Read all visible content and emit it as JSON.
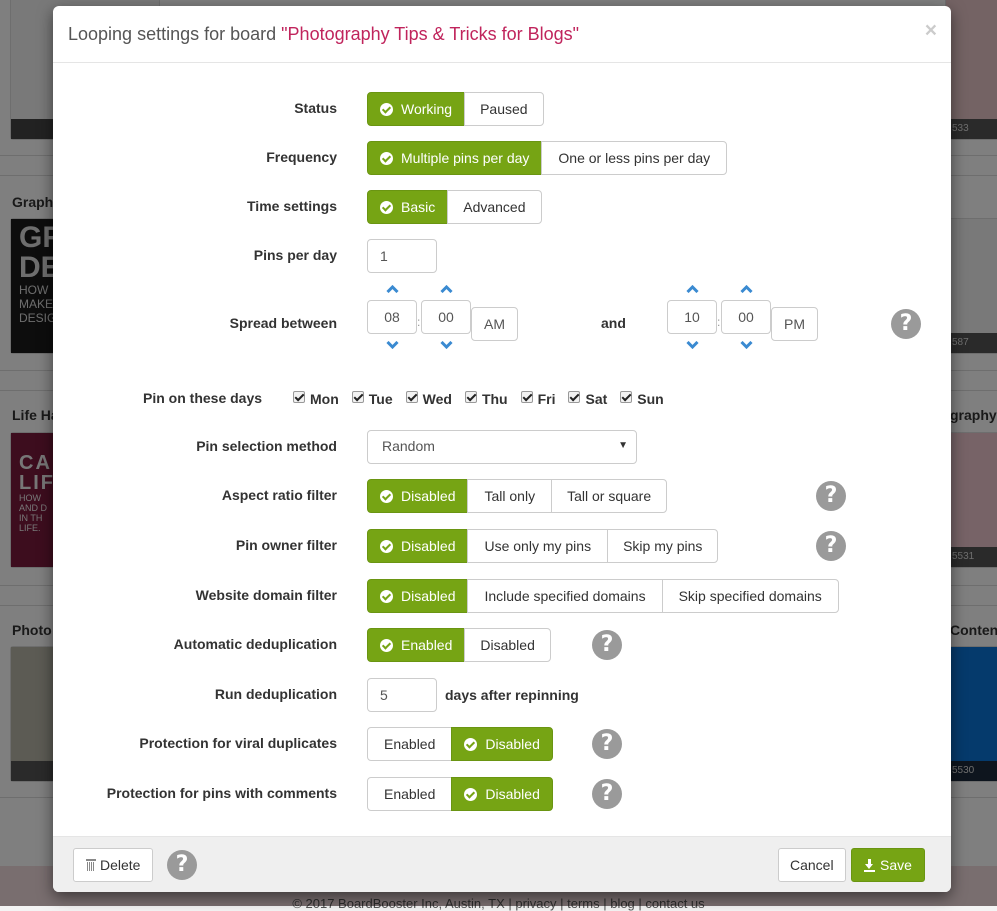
{
  "background": {
    "sections": [
      {
        "heading": "Graph"
      },
      {
        "heading": "Life Ha"
      },
      {
        "heading": "Photo"
      },
      {
        "heading": "graphy"
      },
      {
        "heading": "Content"
      }
    ],
    "card_counts": [
      "533",
      "587",
      "5531",
      "5530"
    ],
    "thumb_texts": {
      "graphic": [
        "GR",
        "DE",
        "HOW",
        "MAKE",
        "DESIG"
      ],
      "life": [
        "CA",
        "LIF",
        "HOW",
        "AND D",
        "IN TH",
        "LIFE."
      ]
    },
    "footer_text": "© 2017 BoardBooster Inc, Austin, TX | privacy | terms | blog | contact us"
  },
  "modal": {
    "title_prefix": "Looping settings for board ",
    "board_name": "\"Photography Tips & Tricks for Blogs\"",
    "close_label": "×",
    "accent_color": "#76a414",
    "board_name_color": "#c0245c",
    "fields": {
      "status": {
        "label": "Status",
        "options": [
          "Working",
          "Paused"
        ],
        "selected": "Working"
      },
      "frequency": {
        "label": "Frequency",
        "options": [
          "Multiple pins per day",
          "One or less pins per day"
        ],
        "selected": "Multiple pins per day"
      },
      "time_settings": {
        "label": "Time settings",
        "options": [
          "Basic",
          "Advanced"
        ],
        "selected": "Basic"
      },
      "pins_per_day": {
        "label": "Pins per day",
        "value": "1"
      },
      "spread_between": {
        "label": "Spread between",
        "start": {
          "hour": "08",
          "minute": "00",
          "period": "AM"
        },
        "and_label": "and",
        "end": {
          "hour": "10",
          "minute": "00",
          "period": "PM"
        },
        "separator": ":"
      },
      "pin_days": {
        "label": "Pin on these days",
        "days": [
          {
            "label": "Mon",
            "checked": true
          },
          {
            "label": "Tue",
            "checked": true
          },
          {
            "label": "Wed",
            "checked": true
          },
          {
            "label": "Thu",
            "checked": true
          },
          {
            "label": "Fri",
            "checked": true
          },
          {
            "label": "Sat",
            "checked": true
          },
          {
            "label": "Sun",
            "checked": true
          }
        ]
      },
      "pin_selection": {
        "label": "Pin selection method",
        "value": "Random"
      },
      "aspect_ratio": {
        "label": "Aspect ratio filter",
        "options": [
          "Disabled",
          "Tall only",
          "Tall or square"
        ],
        "selected": "Disabled"
      },
      "pin_owner": {
        "label": "Pin owner filter",
        "options": [
          "Disabled",
          "Use only my pins",
          "Skip my pins"
        ],
        "selected": "Disabled"
      },
      "website_domain": {
        "label": "Website domain filter",
        "options": [
          "Disabled",
          "Include specified domains",
          "Skip specified domains"
        ],
        "selected": "Disabled"
      },
      "auto_dedup": {
        "label": "Automatic deduplication",
        "options": [
          "Enabled",
          "Disabled"
        ],
        "selected": "Enabled"
      },
      "run_dedup": {
        "label": "Run deduplication",
        "value": "5",
        "suffix": "days after repinning"
      },
      "viral_protection": {
        "label": "Protection for viral duplicates",
        "options": [
          "Enabled",
          "Disabled"
        ],
        "selected": "Disabled"
      },
      "comments_protection": {
        "label": "Protection for pins with comments",
        "options": [
          "Enabled",
          "Disabled"
        ],
        "selected": "Disabled"
      }
    },
    "footer": {
      "delete_label": "Delete",
      "cancel_label": "Cancel",
      "save_label": "Save"
    }
  }
}
